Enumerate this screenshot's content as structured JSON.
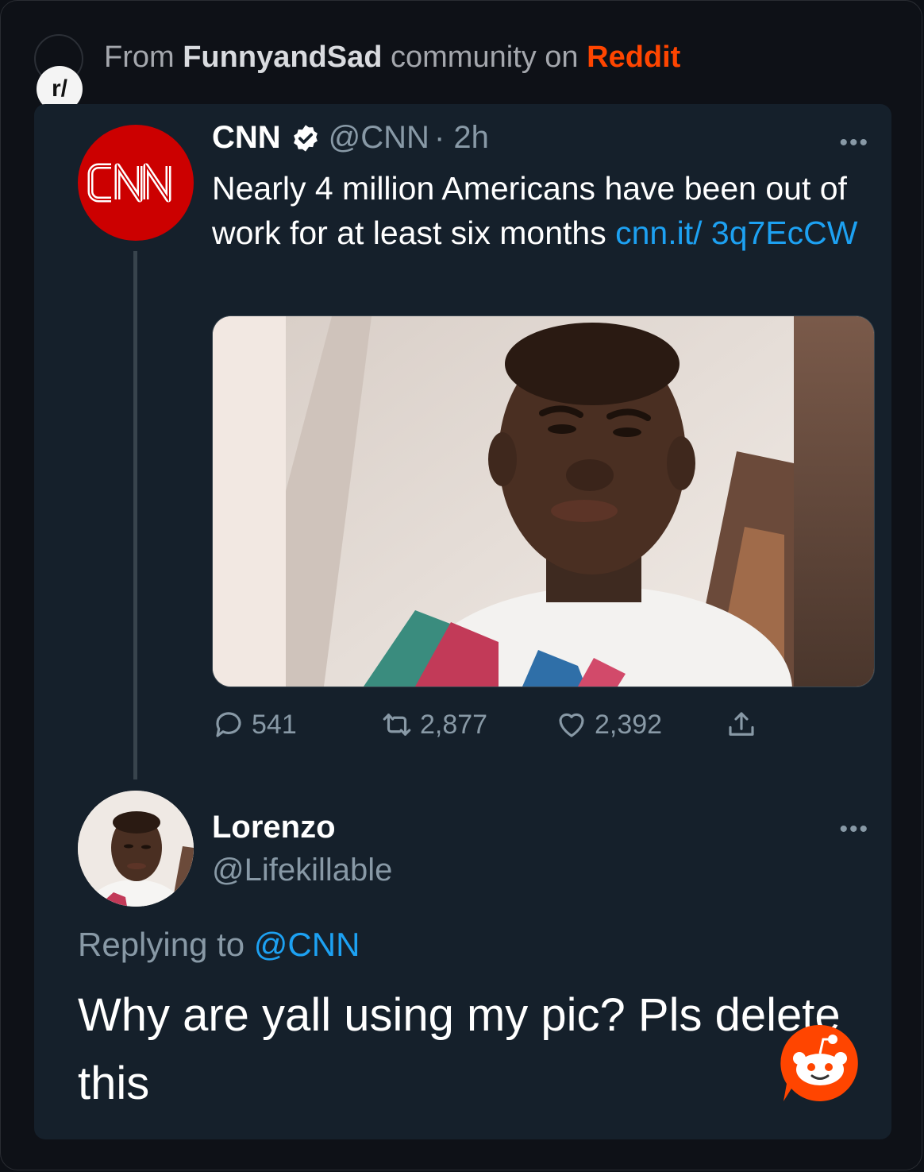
{
  "source": {
    "prefix": "From",
    "subreddit": "FunnyandSad",
    "middle": "community on",
    "platform": "Reddit",
    "badge": "r/"
  },
  "tweet": {
    "name": "CNN",
    "handle": "@CNN",
    "time": "· 2h",
    "text": "Nearly 4 million Americans have been out of work for at least six months ",
    "link": "cnn.it/ 3q7EcCW",
    "replies": "541",
    "retweets": "2,877",
    "likes": "2,392",
    "more": "•••"
  },
  "reply": {
    "name": "Lorenzo",
    "handle": "@Lifekillable",
    "replying_prefix": "Replying to",
    "replying_to": "@CNN",
    "text": "Why are yall using my pic? Pls delete this",
    "more": "•••"
  },
  "colors": {
    "card_bg": "#15202b",
    "link": "#1da1f2",
    "muted": "#8899a6",
    "reddit": "#ff4500",
    "cnn_red": "#cc0000"
  }
}
